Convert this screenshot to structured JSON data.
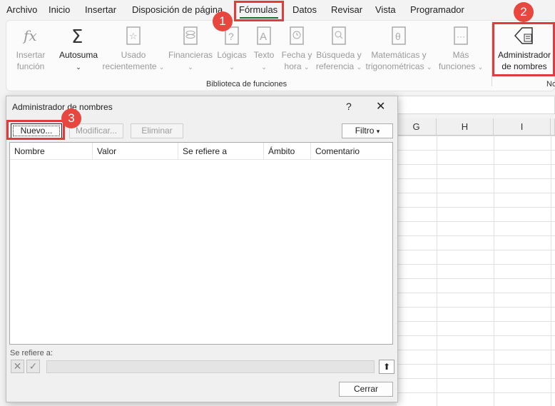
{
  "menu": {
    "tabs": [
      "Archivo",
      "Inicio",
      "Insertar",
      "Disposición de página",
      "Fórmulas",
      "Datos",
      "Revisar",
      "Vista",
      "Programador"
    ],
    "active": "Fórmulas"
  },
  "ribbon": {
    "insert_function": [
      "Insertar",
      "función"
    ],
    "autosum": "Autosuma",
    "recent": [
      "Usado",
      "recientemente"
    ],
    "financial": "Financieras",
    "logical": "Lógicas",
    "text": "Texto",
    "datetime": [
      "Fecha y",
      "hora"
    ],
    "lookup": [
      "Búsqueda y",
      "referencia"
    ],
    "math": [
      "Matemáticas y",
      "trigonométricas"
    ],
    "more": [
      "Más",
      "funciones"
    ],
    "name_manager": [
      "Administrador",
      "de nombres"
    ],
    "group_label": "Biblioteca de funciones",
    "group_label2": "No"
  },
  "sheet": {
    "columns": [
      "G",
      "H",
      "I"
    ]
  },
  "dialog": {
    "title": "Administrador de nombres",
    "help": "?",
    "close": "✕",
    "new_btn": "Nuevo...",
    "edit_btn": "Modificar...",
    "delete_btn": "Eliminar",
    "filter_btn": "Filtro",
    "columns": [
      "Nombre",
      "Valor",
      "Se refiere a",
      "Ámbito",
      "Comentario"
    ],
    "refers_label": "Se refiere a:",
    "close_btn": "Cerrar"
  },
  "callouts": [
    "1",
    "2",
    "3"
  ],
  "colors": {
    "callout": "#e23b3b",
    "badge": "#e8473f",
    "accent": "#1e6e3a"
  }
}
